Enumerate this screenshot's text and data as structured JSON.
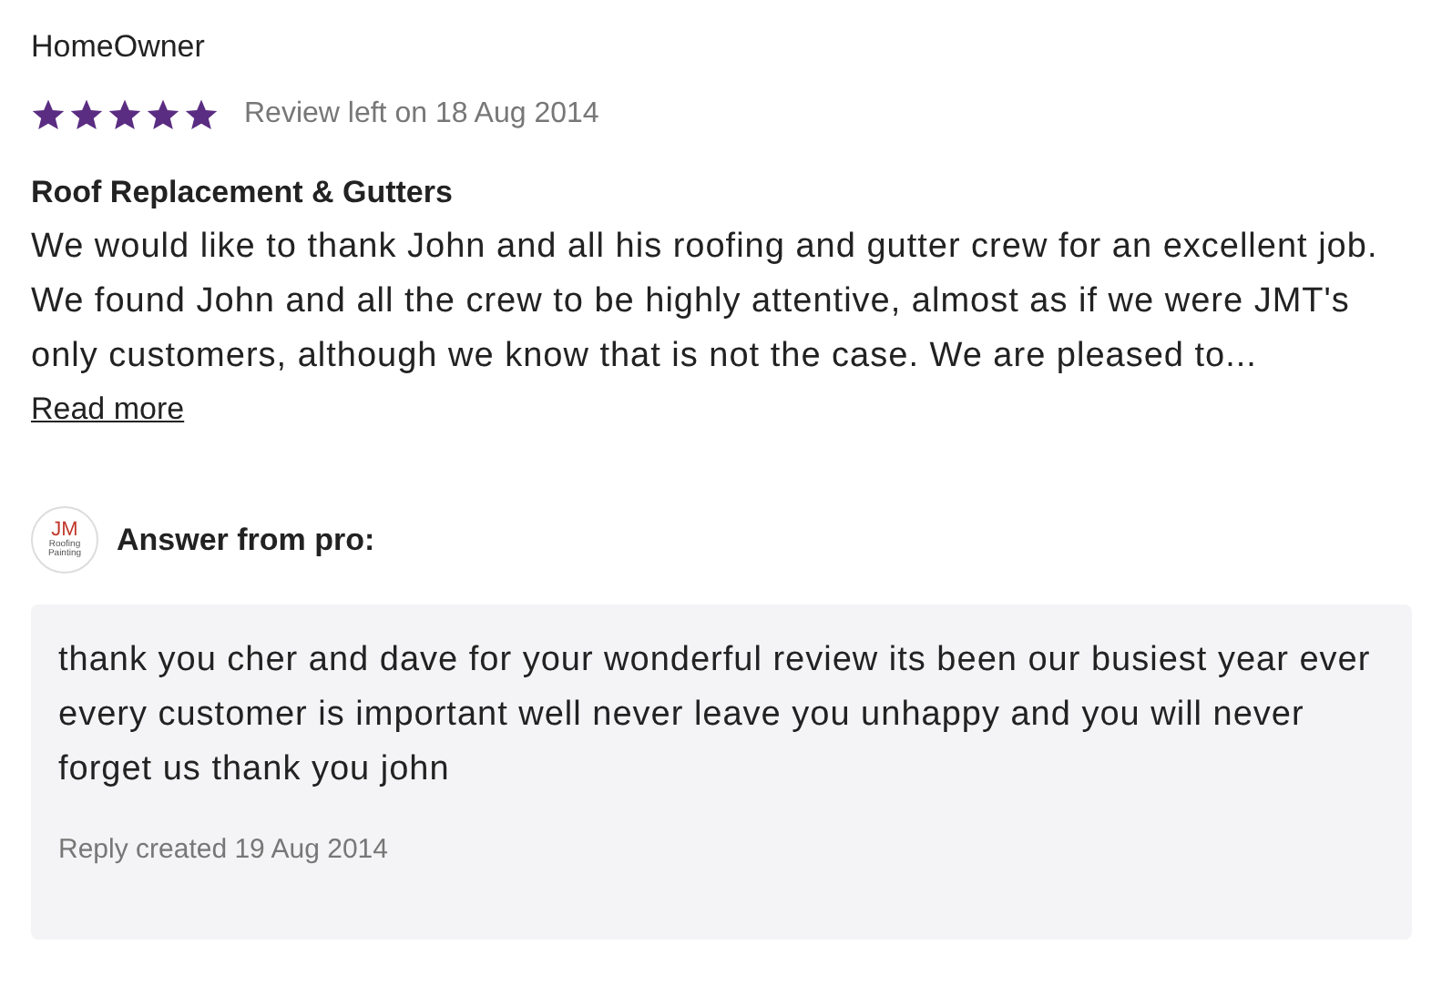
{
  "review": {
    "author": "HomeOwner",
    "stars": 5,
    "date": "Review left on 18 Aug 2014",
    "title": "Roof Replacement & Gutters",
    "body": "We would like to thank John and all his roofing and gutter crew for an excellent job. We found John and all the crew to be highly attentive, almost as if we were JMT's only customers, although we know that is not the case. We are pleased to...",
    "read_more": "Read more"
  },
  "answer": {
    "logo_text": "JM",
    "logo_subtext": "Roofing Painting",
    "heading": "Answer from pro:",
    "body": "thank you cher and dave for your wonderful review its been our busiest year ever every customer is important well never leave you unhappy and you will never forget us thank you john",
    "date": "Reply created 19 Aug 2014"
  }
}
